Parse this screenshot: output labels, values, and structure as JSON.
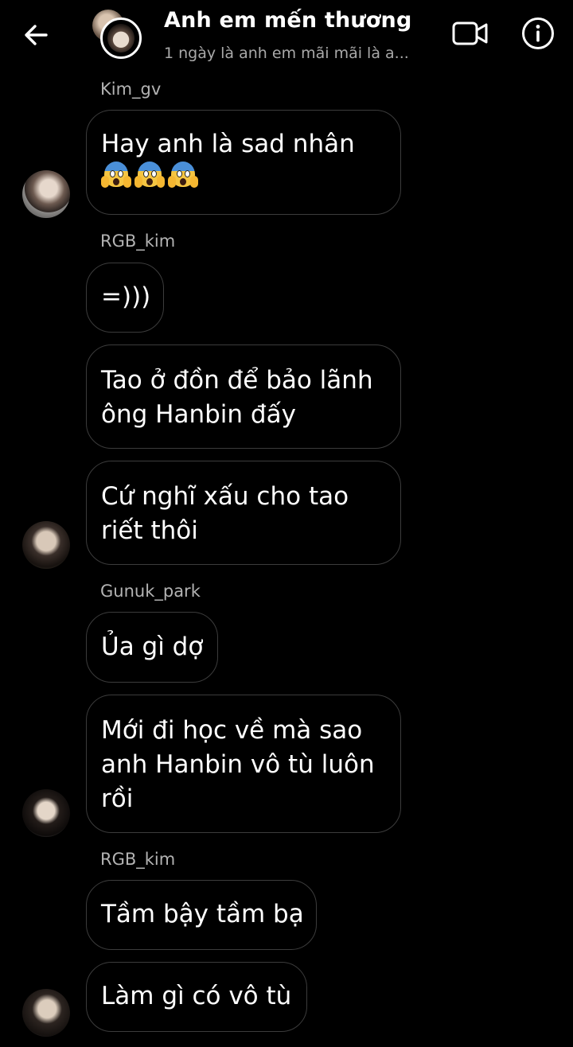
{
  "header": {
    "title": "Anh em mến thương",
    "subtitle": "1 ngày là anh em mãi mãi là a...",
    "back_icon": "arrow-left-icon",
    "video_icon": "video-camera-icon",
    "info_icon": "info-circle-icon"
  },
  "messages": {
    "sender_1": "Kim_gv",
    "m1": {
      "line1": "Hay anh là sad nhân",
      "emoji": "face-screaming-in-fear-emoji",
      "emoji_count": 3
    },
    "sender_2": "RGB_kim",
    "m2": {
      "line1": "=)))"
    },
    "m3": {
      "line1": "Tao ở đồn để bảo lãnh",
      "line2": "ông Hanbin đấy"
    },
    "m4": {
      "line1": "Cứ nghĩ xấu cho tao",
      "line2": "riết thôi"
    },
    "sender_3": "Gunuk_park",
    "m5": {
      "line1": "Ủa gì dợ"
    },
    "m6": {
      "line1": "Mới đi học về mà sao",
      "line2": "anh Hanbin vô tù luôn",
      "line3": "rồi"
    },
    "sender_4": "RGB_kim",
    "m7": {
      "line1": "Tầm bậy tầm bạ"
    },
    "m8": {
      "line1": "Làm gì có vô tù"
    }
  },
  "colors": {
    "background": "#000000",
    "bubble_border": "#3c3c3c",
    "sender_text": "#b3b3b3",
    "subtitle_text": "#a9a9a9"
  }
}
